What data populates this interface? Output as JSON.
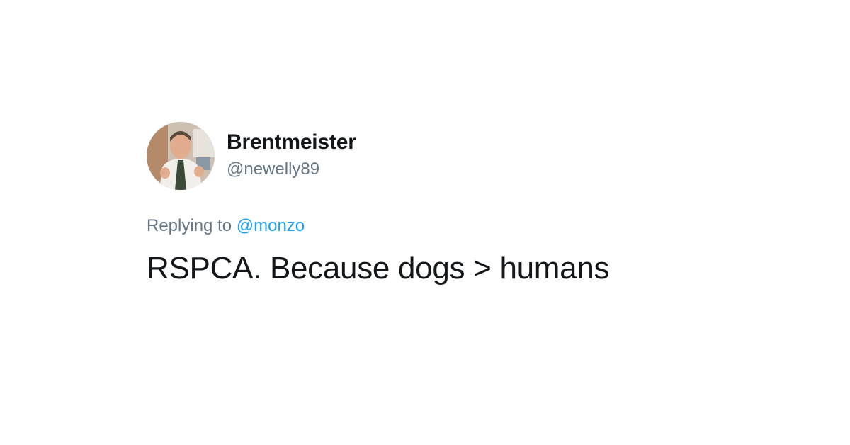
{
  "tweet": {
    "author": {
      "display_name": "Brentmeister",
      "handle": "@newelly89",
      "avatar_icon": "user-avatar-photo"
    },
    "reply": {
      "prefix": "Replying to ",
      "mention": "@monzo"
    },
    "text": "RSPCA. Because dogs > humans"
  },
  "colors": {
    "text_primary": "#14171a",
    "text_secondary": "#657786",
    "link": "#1da1f2",
    "background": "#ffffff"
  }
}
